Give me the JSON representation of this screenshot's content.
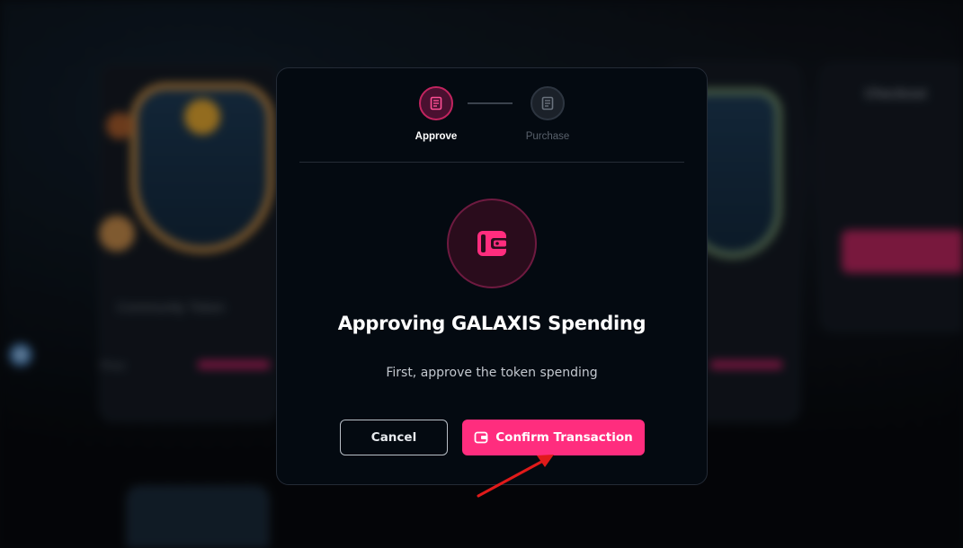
{
  "background": {
    "left_card_title": "Community Token",
    "left_price_label": "Price",
    "checkout_title": "Checkout"
  },
  "modal": {
    "steps": [
      {
        "label": "Approve",
        "state": "active",
        "icon": "receipt-icon"
      },
      {
        "label": "Purchase",
        "state": "inactive",
        "icon": "receipt-icon"
      }
    ],
    "title": "Approving GALAXIS Spending",
    "subtitle": "First, approve the token spending",
    "cancel_label": "Cancel",
    "confirm_label": "Confirm Transaction",
    "accent_color": "#ff2d7e"
  }
}
